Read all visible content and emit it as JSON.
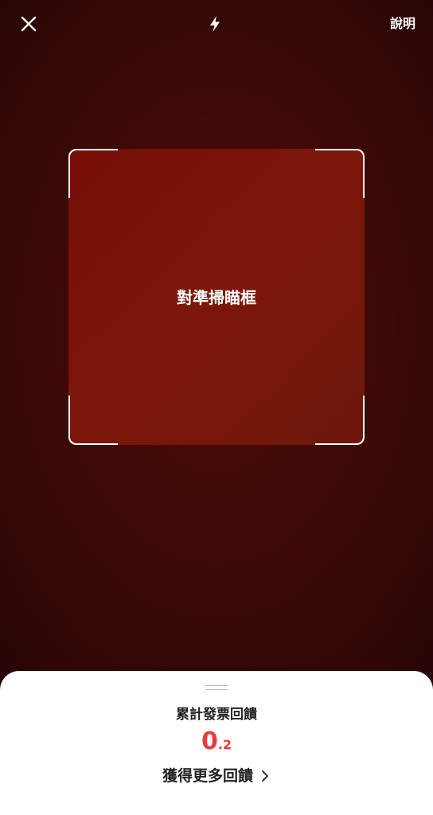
{
  "header": {
    "close_icon": "close-icon",
    "flash_icon": "flash-icon",
    "help_label": "說明"
  },
  "scanner": {
    "hint": "對準掃瞄框"
  },
  "sheet": {
    "title": "累計發票回饋",
    "amount_integer": "0",
    "amount_decimal": ".2",
    "link_label": "獲得更多回饋",
    "link_icon": "chevron-right-icon"
  },
  "colors": {
    "background": "#3a0907",
    "scan_area": "#770f08",
    "accent": "#e93b3b",
    "sheet_background": "#ffffff"
  }
}
